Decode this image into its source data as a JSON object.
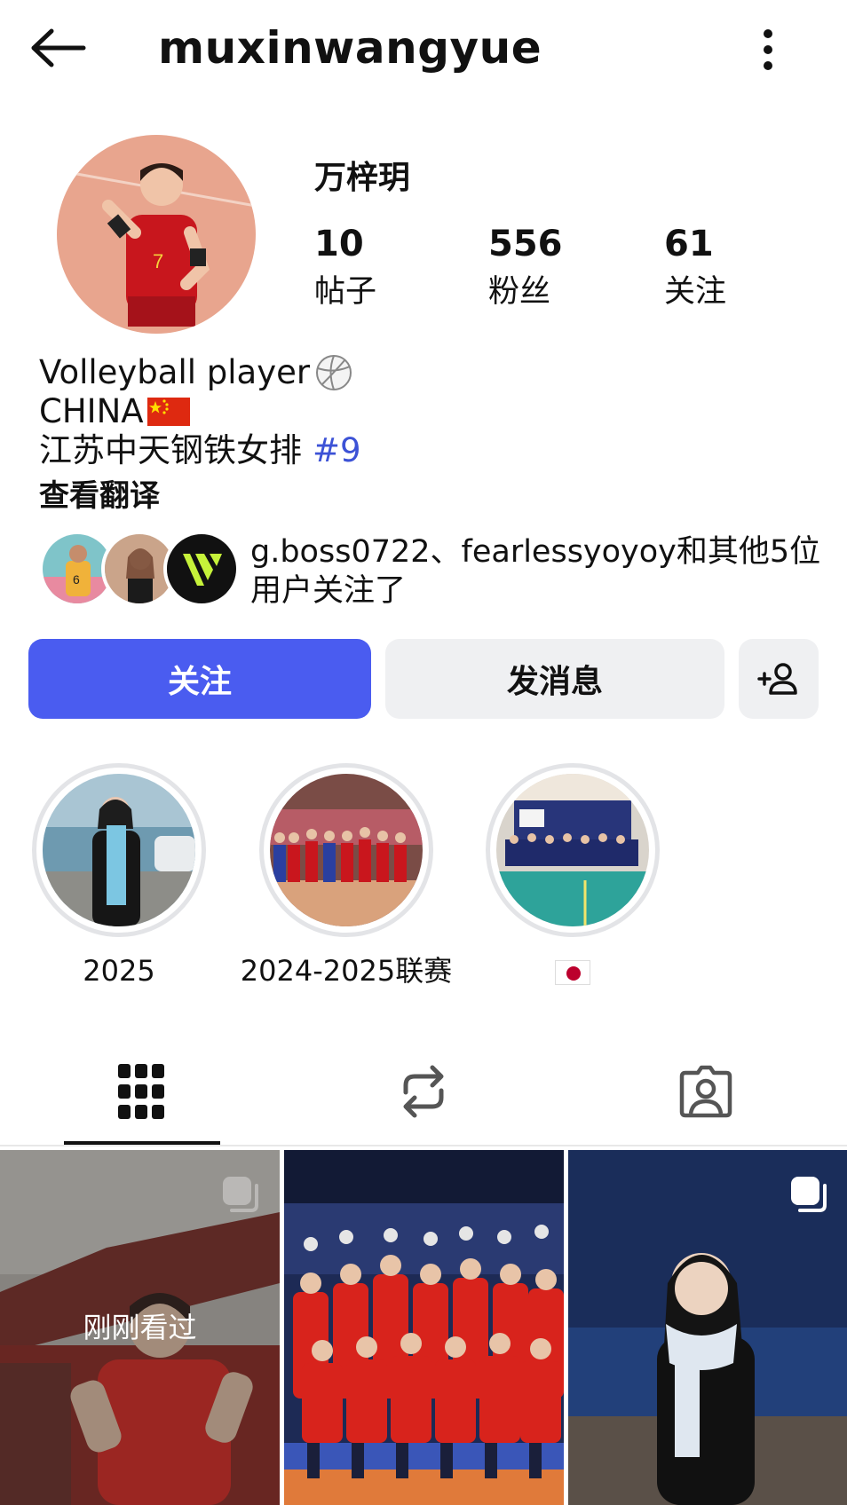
{
  "header": {
    "username": "muxinwangyue",
    "back_icon": "arrow-left-icon",
    "more_icon": "more-vertical-icon"
  },
  "profile": {
    "display_name": "万梓玥",
    "stats": [
      {
        "count": "10",
        "label": "帖子"
      },
      {
        "count": "556",
        "label": "粉丝"
      },
      {
        "count": "61",
        "label": "关注"
      }
    ]
  },
  "bio": {
    "line1": "Volleyball player",
    "line1_emoji": "volleyball-icon",
    "line2": "CHINA",
    "line2_emoji": "china-flag-icon",
    "line3": "江苏中天钢铁女排",
    "line3_hashtag": "#9",
    "translate": "查看翻译"
  },
  "followed_by": {
    "text": "g.boss0722、fearlessyoyoy和其他5位用户关注了"
  },
  "actions": {
    "follow": "关注",
    "message": "发消息",
    "add_user_icon": "add-user-icon"
  },
  "highlights": [
    {
      "label": "2025"
    },
    {
      "label": "2024-2025联赛"
    },
    {
      "label": "",
      "label_icon": "japan-flag-icon"
    }
  ],
  "tabs": [
    {
      "name": "posts-grid",
      "icon": "grid-icon"
    },
    {
      "name": "reposts",
      "icon": "repost-icon"
    },
    {
      "name": "tagged",
      "icon": "tagged-person-icon"
    }
  ],
  "posts": [
    {
      "overlay_text": "刚刚看过",
      "multi": true
    },
    {
      "overlay_text": "",
      "multi": false
    },
    {
      "overlay_text": "",
      "multi": true
    }
  ],
  "colors": {
    "accent": "#4a5cf0",
    "hashtag": "#3c52d6",
    "button_secondary": "#eff0f2"
  }
}
